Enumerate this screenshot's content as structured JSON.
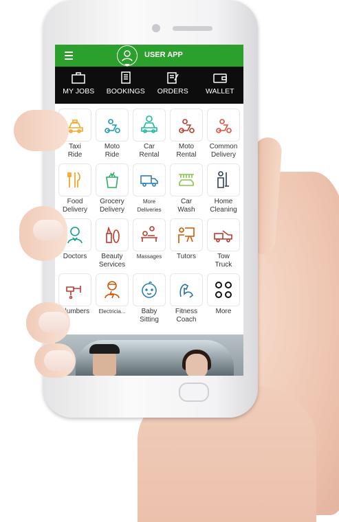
{
  "app": {
    "title": "USER APP"
  },
  "tabs": [
    {
      "label": "MY JOBS",
      "icon": "briefcase-icon"
    },
    {
      "label": "BOOKINGS",
      "icon": "document-icon"
    },
    {
      "label": "ORDERS",
      "icon": "order-edit-icon"
    },
    {
      "label": "WALLET",
      "icon": "wallet-icon"
    }
  ],
  "services": [
    {
      "label": "Taxi\nRide",
      "icon": "taxi-icon",
      "color": "#f5a623"
    },
    {
      "label": "Moto\nRide",
      "icon": "moto-ride-icon",
      "color": "#1a9ab8"
    },
    {
      "label": "Car\nRental",
      "icon": "car-rental-icon",
      "color": "#1abc9c"
    },
    {
      "label": "Moto\nRental",
      "icon": "moto-rental-icon",
      "color": "#c0392b"
    },
    {
      "label": "Common\nDelivery",
      "icon": "delivery-scooter-icon",
      "color": "#e74c3c"
    },
    {
      "label": "Food\nDelivery",
      "icon": "food-icon",
      "color": "#f39c12"
    },
    {
      "label": "Grocery\nDelivery",
      "icon": "grocery-bag-icon",
      "color": "#27ae60"
    },
    {
      "label": "More\nDeliveries",
      "icon": "truck-icon",
      "color": "#2980b9"
    },
    {
      "label": "Car\nWash",
      "icon": "car-wash-icon",
      "color": "#8bc34a"
    },
    {
      "label": "Home\nCleaning",
      "icon": "cleaning-icon",
      "color": "#2c3e50"
    },
    {
      "label": "Doctors",
      "icon": "doctor-icon",
      "color": "#16a085"
    },
    {
      "label": "Beauty\nServices",
      "icon": "beauty-icon",
      "color": "#c0392b"
    },
    {
      "label": "Massages",
      "icon": "massage-icon",
      "color": "#c0392b"
    },
    {
      "label": "Tutors",
      "icon": "tutor-icon",
      "color": "#d35400"
    },
    {
      "label": "Tow\nTruck",
      "icon": "tow-truck-icon",
      "color": "#c0392b"
    },
    {
      "label": "Plumbers",
      "icon": "plumber-icon",
      "color": "#c0392b"
    },
    {
      "label": "Electricia...",
      "icon": "electrician-icon",
      "color": "#d35400"
    },
    {
      "label": "Baby\nSitting",
      "icon": "baby-icon",
      "color": "#2980b9"
    },
    {
      "label": "Fitness\nCoach",
      "icon": "fitness-icon",
      "color": "#2471a3"
    },
    {
      "label": "More",
      "icon": "more-grid-icon",
      "color": "#111111"
    }
  ],
  "colors": {
    "header": "#2ca02c",
    "tabbar": "#0d0d0d"
  }
}
